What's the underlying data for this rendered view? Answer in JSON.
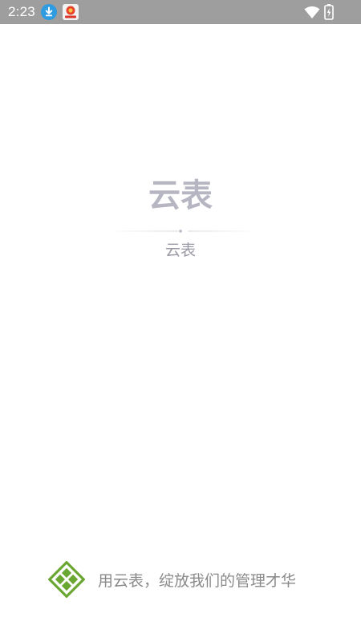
{
  "status_bar": {
    "time": "2:23",
    "background": "#9e9e9e",
    "icons": [
      "download-icon",
      "app-notification-icon",
      "wifi-icon",
      "battery-charging-icon"
    ]
  },
  "splash": {
    "title": "云表",
    "subtitle": "云表",
    "title_color": "#b6b6c2"
  },
  "footer": {
    "slogan": "用云表，绽放我们的管理才华",
    "logo_icon": "yunbiao-logo-icon",
    "logo_color": "#6aa632"
  }
}
